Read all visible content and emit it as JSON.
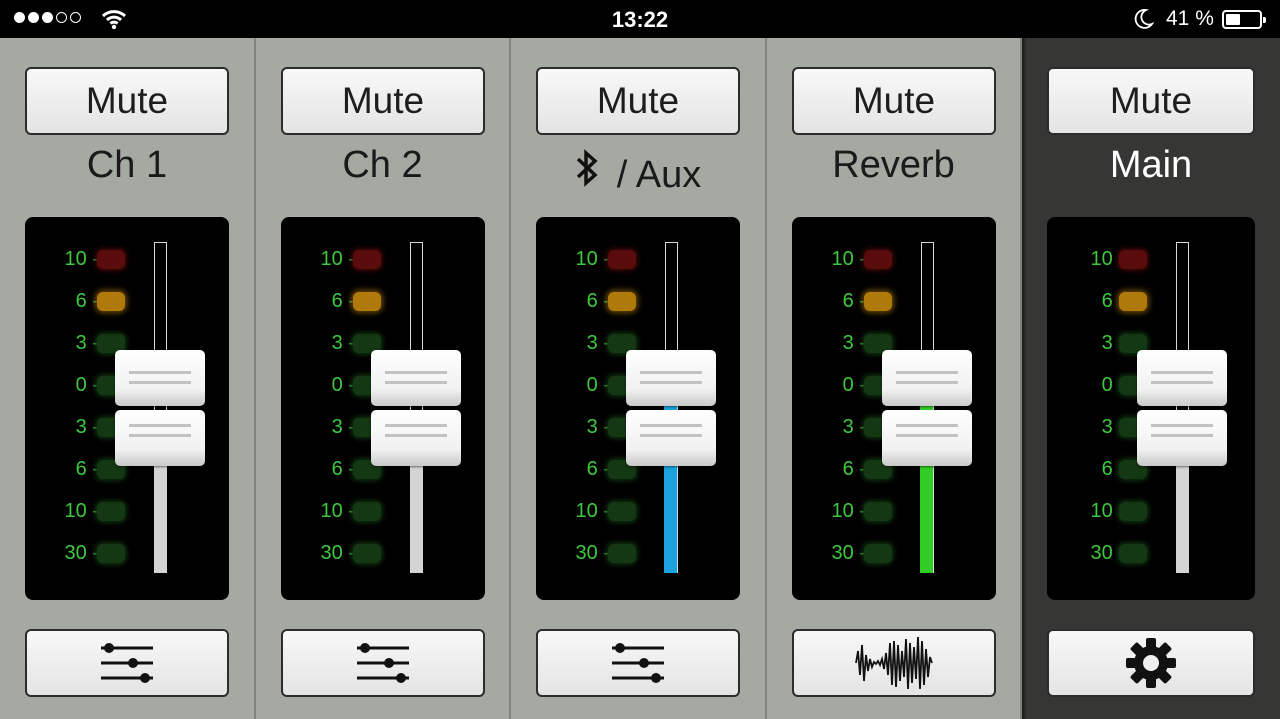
{
  "status_bar": {
    "time": "13:22",
    "battery_percent": "41 %",
    "signal_bars_filled": 3,
    "signal_bars_total": 5,
    "battery_level": 0.41,
    "icons": [
      "signal-dots",
      "wifi-icon",
      "moon-icon",
      "battery-icon"
    ]
  },
  "meter_scale": [
    "10 -",
    "6 -",
    "3 -",
    "0 -",
    "3 -",
    "6 -",
    "10 -",
    "30 -"
  ],
  "colors": {
    "strip_bg": "#a4aaa1",
    "main_strip_bg": "#363734",
    "meter_text": "#3ec83e",
    "aux_level": "#1ba3dd",
    "reverb_level": "#32cd24",
    "idle_level": "#d4d4d4"
  },
  "channels": [
    {
      "id": "ch1",
      "mute_label": "Mute",
      "name": "Ch 1",
      "level_color": "idle",
      "tool_icon": "sliders-icon"
    },
    {
      "id": "ch2",
      "mute_label": "Mute",
      "name": "Ch 2",
      "level_color": "idle",
      "tool_icon": "sliders-icon"
    },
    {
      "id": "aux",
      "mute_label": "Mute",
      "name_icon": "bluetooth-icon",
      "name": "/ Aux",
      "level_color": "aux",
      "tool_icon": "sliders-icon"
    },
    {
      "id": "reverb",
      "mute_label": "Mute",
      "name": "Reverb",
      "level_color": "reverb",
      "tool_icon": "waveform-icon"
    },
    {
      "id": "main",
      "mute_label": "Mute",
      "name": "Main",
      "level_color": "idle",
      "tool_icon": "gear-icon"
    }
  ]
}
